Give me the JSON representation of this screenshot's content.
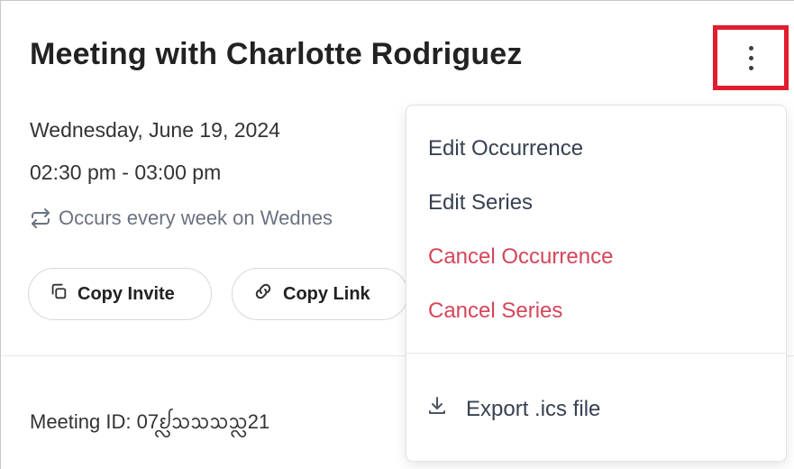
{
  "meeting": {
    "title": "Meeting with Charlotte Rodriguez",
    "date": "Wednesday, June 19, 2024",
    "time": "02:30 pm - 03:00 pm",
    "recurrence": "Occurs every week on Wednes",
    "meeting_id_label": "Meeting ID: 07ᩀᩖᩈᩈᩈᩈᩖ21"
  },
  "actions": {
    "copy_invite": "Copy Invite",
    "copy_link": "Copy Link"
  },
  "menu": {
    "items": [
      {
        "label": "Edit Occurrence",
        "style": "normal"
      },
      {
        "label": "Edit Series",
        "style": "normal"
      },
      {
        "label": "Cancel Occurrence",
        "style": "danger"
      },
      {
        "label": "Cancel Series",
        "style": "danger"
      }
    ],
    "export_label": "Export .ics file"
  },
  "icons": {
    "more": "more-vertical-icon",
    "recurrence": "repeat-icon",
    "copy_invite": "copy-icon",
    "copy_link": "link-icon",
    "export": "download-icon"
  },
  "colors": {
    "danger": "#d6455a",
    "highlight_box": "#e11d2e"
  }
}
